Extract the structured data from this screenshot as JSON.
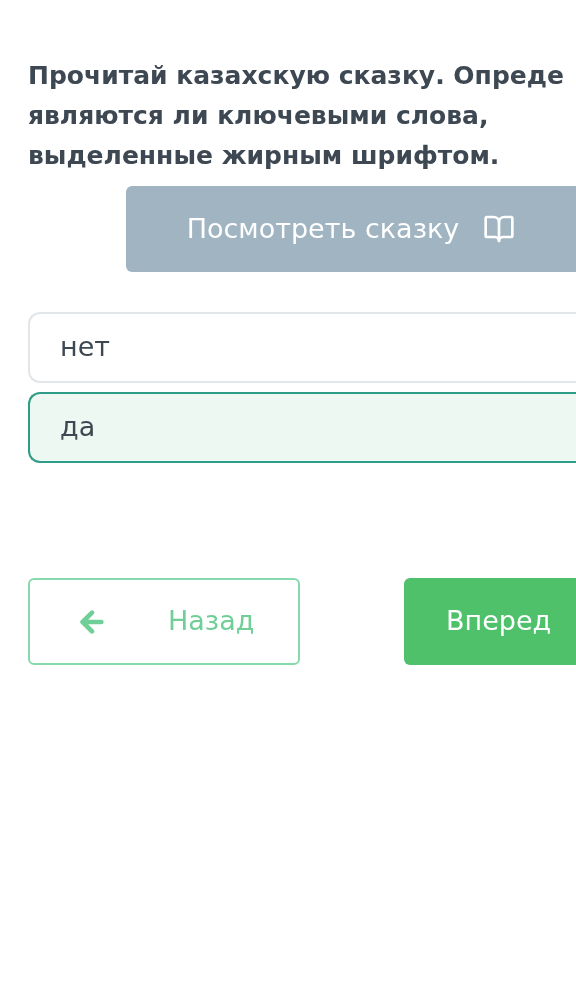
{
  "question": "Прочитай казахскую сказку. Опреде\nявляются ли ключевыми слова,\nвыделенные жирным шрифтом.",
  "story_button": "Посмотреть сказку",
  "options": [
    {
      "label": "нет",
      "selected": false
    },
    {
      "label": "да",
      "selected": true
    }
  ],
  "back_button": "Назад",
  "next_button": "Вперед"
}
